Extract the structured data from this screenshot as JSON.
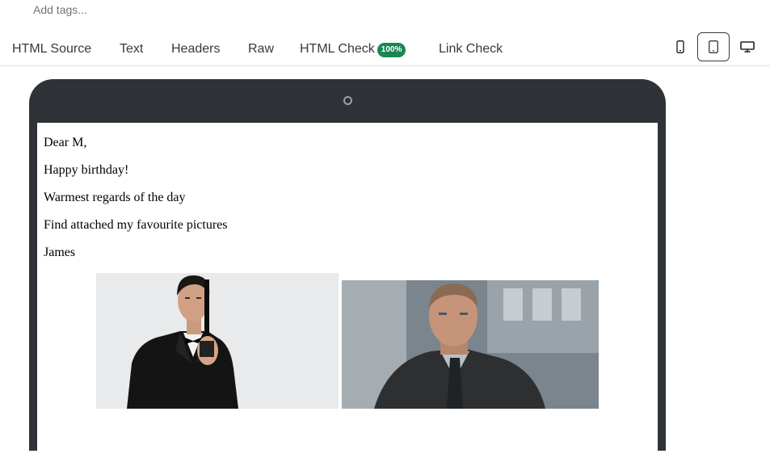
{
  "tags": {
    "placeholder": "Add tags..."
  },
  "tabs": [
    {
      "label": "HTML Source"
    },
    {
      "label": "Text"
    },
    {
      "label": "Headers"
    },
    {
      "label": "Raw"
    },
    {
      "label": "HTML Check",
      "badge": "100%"
    },
    {
      "label": "Link Check"
    }
  ],
  "device_toggle": {
    "options": [
      "mobile",
      "tablet",
      "desktop"
    ],
    "selected": "tablet"
  },
  "email": {
    "lines": [
      "Dear M,",
      "Happy birthday!",
      "Warmest regards of the day",
      "Find attached my favourite pictures",
      "James"
    ]
  },
  "colors": {
    "badge": "#198754",
    "device_frame": "#2f3337",
    "tab_text": "#343a40"
  }
}
